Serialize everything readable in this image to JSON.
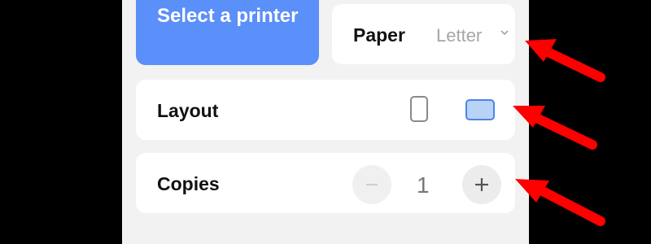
{
  "printer": {
    "select_label": "Select a printer"
  },
  "paper": {
    "label": "Paper",
    "value": "Letter"
  },
  "layout": {
    "label": "Layout",
    "options": [
      "portrait",
      "landscape"
    ],
    "selected": "landscape"
  },
  "copies": {
    "label": "Copies",
    "count": "1"
  },
  "icons": {
    "chevron": "chevron-down-icon",
    "minus": "minus-icon",
    "plus": "plus-icon",
    "portrait": "portrait-orientation-icon",
    "landscape": "landscape-orientation-icon",
    "annotation_arrow": "red-arrow-icon"
  },
  "colors": {
    "accent": "#5b8ff9",
    "annotation": "#ff0000",
    "background": "#000000",
    "panel": "#f2f2f2"
  }
}
